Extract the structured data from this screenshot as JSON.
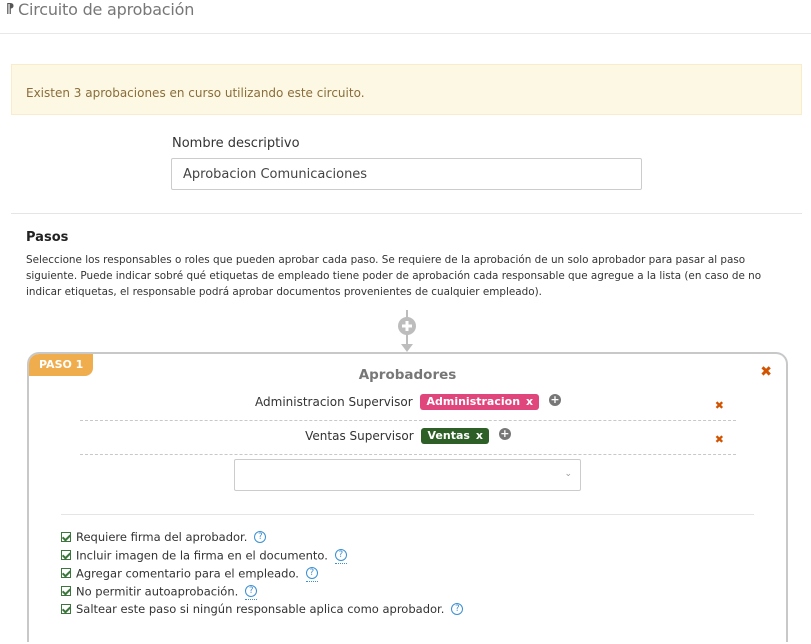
{
  "header": {
    "title": "Circuito de aprobación",
    "icon": "flow-icon"
  },
  "alert": {
    "text": "Existen 3 aprobaciones en curso utilizando este circuito."
  },
  "form": {
    "name_label": "Nombre descriptivo",
    "name_value": "Aprobacion Comunicaciones"
  },
  "steps_section": {
    "title": "Pasos",
    "description": "Seleccione los responsables o roles que pueden aprobar cada paso. Se requiere de la aprobación de un solo aprobador para pasar al paso siguiente. Puede indicar sobré qué etiquetas de empleado tiene poder de aprobación cada responsable que agregue a la lista (en caso de no indicar etiquetas, el responsable podrá aprobar documentos provenientes de cualquier empleado)."
  },
  "step": {
    "badge": "PASO 1",
    "approvers_title": "Aprobadores",
    "approvers": [
      {
        "name": "Administracion Supervisor",
        "tag": "Administracion",
        "tag_color": "#e0457b"
      },
      {
        "name": "Ventas Supervisor",
        "tag": "Ventas",
        "tag_color": "#2e5f26"
      }
    ],
    "select_value": "",
    "options": [
      {
        "label": "Requiere firma del aprobador.",
        "checked": true
      },
      {
        "label": "Incluir imagen de la firma en el documento.",
        "checked": true
      },
      {
        "label": "Agregar comentario para el empleado.",
        "checked": true
      },
      {
        "label": "No permitir autoaprobación.",
        "checked": true
      },
      {
        "label": "Saltear este paso si ningún responsable aplica como aprobador.",
        "checked": true
      }
    ]
  },
  "colors": {
    "accent_orange": "#f0ad4e",
    "remove_x": "#d35400",
    "help_blue": "#3b8fd4",
    "check_green": "#3c763d"
  }
}
